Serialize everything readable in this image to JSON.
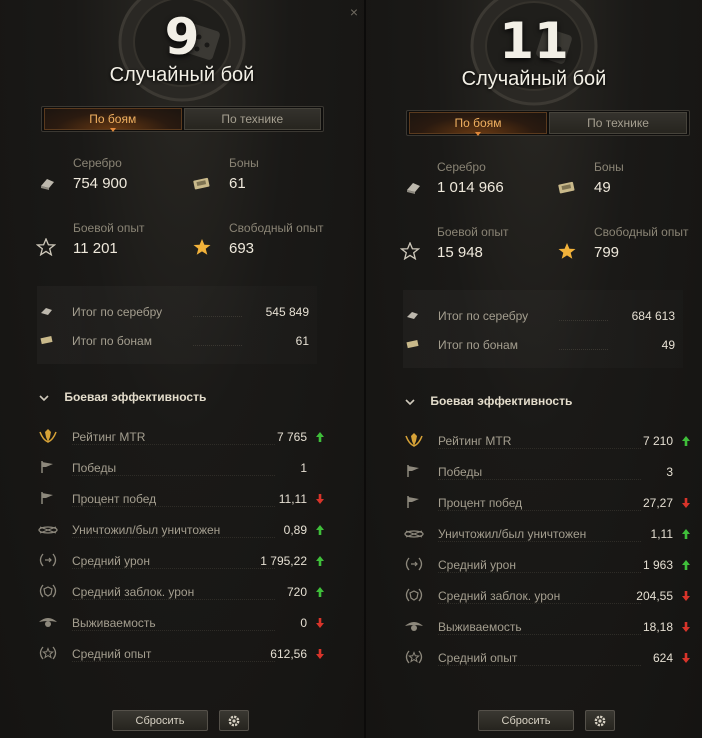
{
  "close_icon_glyph": "×",
  "panels": [
    {
      "battle_count": "9",
      "battle_type": "Случайный бой",
      "tabs": [
        {
          "label": "По боям",
          "active": true
        },
        {
          "label": "По технике",
          "active": false
        }
      ],
      "silver": {
        "label": "Серебро",
        "value": "754 900",
        "icon": "silver-icon"
      },
      "bonds": {
        "label": "Боны",
        "value": "61",
        "icon": "bonds-icon"
      },
      "combat_xp": {
        "label": "Боевой опыт",
        "value": "11 201",
        "icon": "star-outline-icon"
      },
      "free_xp": {
        "label": "Свободный опыт",
        "value": "693",
        "icon": "star-filled-icon"
      },
      "totals": [
        {
          "label": "Итог по серебру",
          "value": "545 849",
          "icon": "silver-icon"
        },
        {
          "label": "Итог по бонам",
          "value": "61",
          "icon": "bonds-icon"
        }
      ],
      "efficiency_title": "Боевая эффективность",
      "efficiency": [
        {
          "label": "Рейтинг MTR",
          "value": "7 765",
          "trend": "up",
          "icon": "mtr-rating-icon"
        },
        {
          "label": "Победы",
          "value": "1",
          "trend": "none",
          "icon": "flag-icon"
        },
        {
          "label": "Процент побед",
          "value": "11,11",
          "trend": "down",
          "icon": "flag-icon"
        },
        {
          "label": "Уничтожил/был уничтожен",
          "value": "0,89",
          "trend": "up",
          "icon": "destroyed-ratio-icon"
        },
        {
          "label": "Средний урон",
          "value": "1 795,22",
          "trend": "up",
          "icon": "damage-icon"
        },
        {
          "label": "Средний заблок. урон",
          "value": "720",
          "trend": "up",
          "icon": "blocked-damage-icon"
        },
        {
          "label": "Выживаемость",
          "value": "0",
          "trend": "down",
          "icon": "survival-icon"
        },
        {
          "label": "Средний опыт",
          "value": "612,56",
          "trend": "down",
          "icon": "avg-xp-icon"
        }
      ],
      "reset_label": "Сбросить"
    },
    {
      "battle_count": "11",
      "battle_type": "Случайный бой",
      "tabs": [
        {
          "label": "По боям",
          "active": true
        },
        {
          "label": "По технике",
          "active": false
        }
      ],
      "silver": {
        "label": "Серебро",
        "value": "1 014 966",
        "icon": "silver-icon"
      },
      "bonds": {
        "label": "Боны",
        "value": "49",
        "icon": "bonds-icon"
      },
      "combat_xp": {
        "label": "Боевой опыт",
        "value": "15 948",
        "icon": "star-outline-icon"
      },
      "free_xp": {
        "label": "Свободный опыт",
        "value": "799",
        "icon": "star-filled-icon"
      },
      "totals": [
        {
          "label": "Итог по серебру",
          "value": "684 613",
          "icon": "silver-icon"
        },
        {
          "label": "Итог по бонам",
          "value": "49",
          "icon": "bonds-icon"
        }
      ],
      "efficiency_title": "Боевая эффективность",
      "efficiency": [
        {
          "label": "Рейтинг MTR",
          "value": "7 210",
          "trend": "up",
          "icon": "mtr-rating-icon"
        },
        {
          "label": "Победы",
          "value": "3",
          "trend": "none",
          "icon": "flag-icon"
        },
        {
          "label": "Процент побед",
          "value": "27,27",
          "trend": "down",
          "icon": "flag-icon"
        },
        {
          "label": "Уничтожил/был уничтожен",
          "value": "1,11",
          "trend": "up",
          "icon": "destroyed-ratio-icon"
        },
        {
          "label": "Средний урон",
          "value": "1 963",
          "trend": "up",
          "icon": "damage-icon"
        },
        {
          "label": "Средний заблок. урон",
          "value": "204,55",
          "trend": "down",
          "icon": "blocked-damage-icon"
        },
        {
          "label": "Выживаемость",
          "value": "18,18",
          "trend": "down",
          "icon": "survival-icon"
        },
        {
          "label": "Средний опыт",
          "value": "624",
          "trend": "down",
          "icon": "avg-xp-icon"
        }
      ],
      "reset_label": "Сбросить"
    }
  ],
  "colors": {
    "trend_up": "#3fbf3a",
    "trend_down": "#d8342a",
    "accent_tab": "#f0b060",
    "gold_star": "#f2b23a"
  }
}
